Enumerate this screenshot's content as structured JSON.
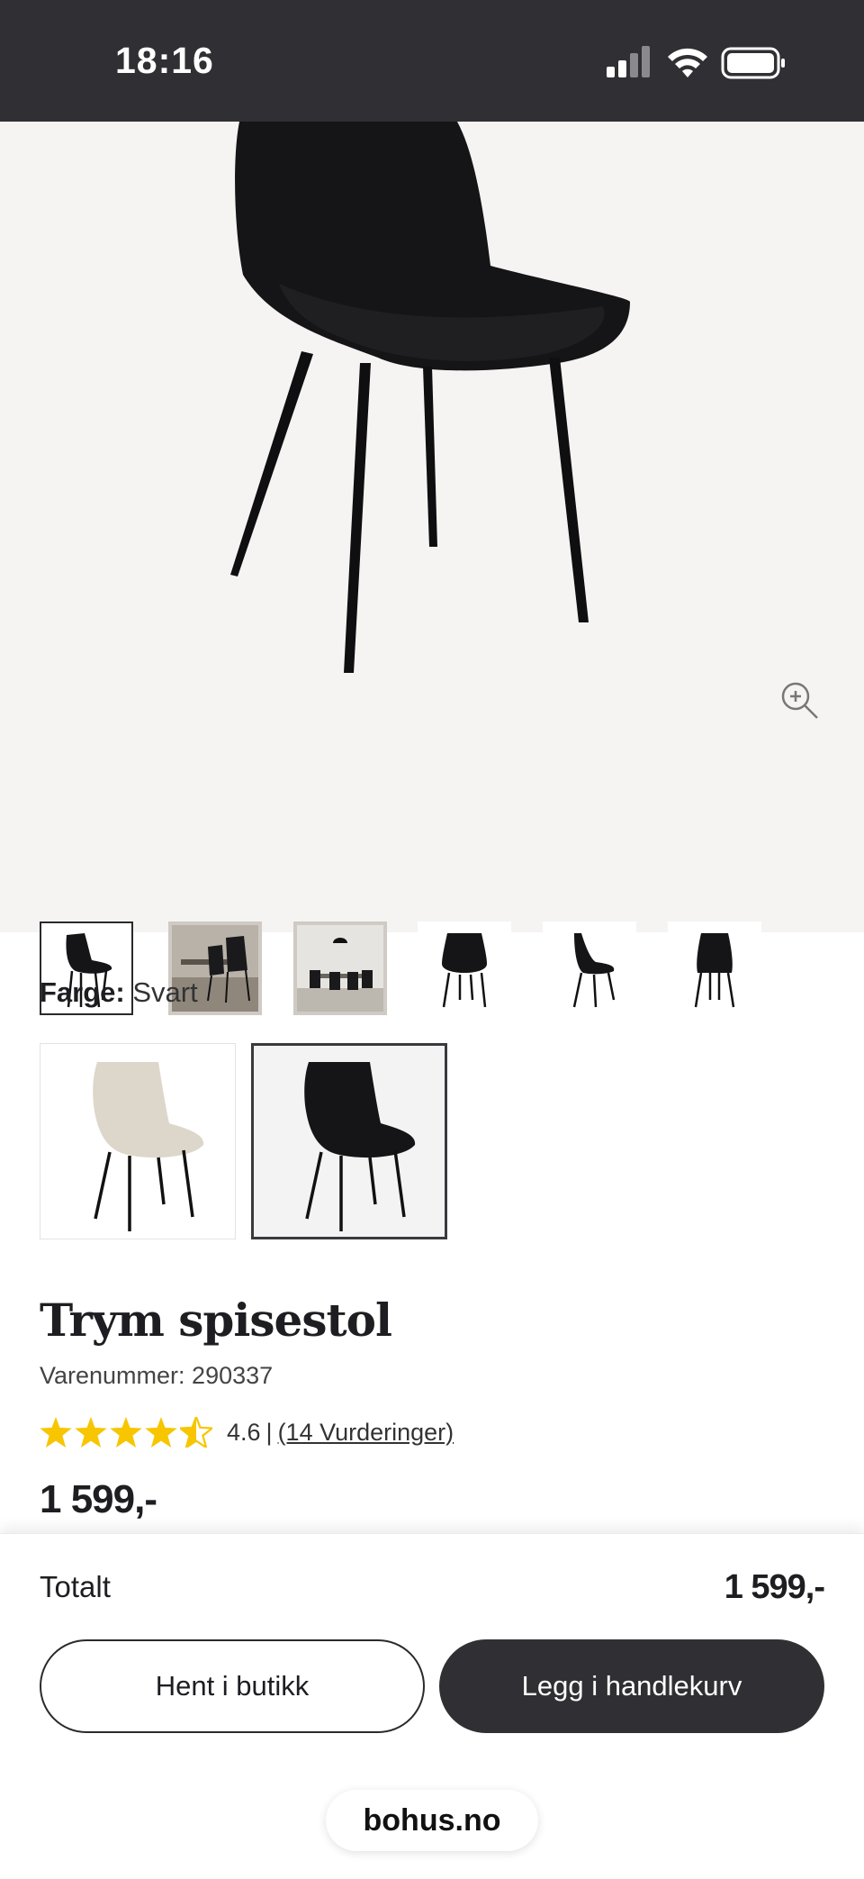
{
  "status_bar": {
    "time": "18:16",
    "icons": [
      "signal-icon",
      "wifi-icon",
      "battery-icon"
    ]
  },
  "gallery": {
    "main_image": "chair-black-image",
    "zoom_icon": "zoom-in-icon",
    "thumbnails": [
      {
        "name": "thumbnail-chair-side",
        "selected": true
      },
      {
        "name": "thumbnail-dining-room-1",
        "selected": false
      },
      {
        "name": "thumbnail-dining-room-2",
        "selected": false
      },
      {
        "name": "thumbnail-chair-front",
        "selected": false
      },
      {
        "name": "thumbnail-chair-profile",
        "selected": false
      },
      {
        "name": "thumbnail-chair-back",
        "selected": false
      }
    ]
  },
  "color": {
    "label": "Farge:",
    "value": "Svart",
    "options": [
      {
        "name": "beige",
        "selected": false,
        "hex": "#ddd6cb"
      },
      {
        "name": "black",
        "selected": true,
        "hex": "#1a1a1c"
      }
    ]
  },
  "product": {
    "title": "Trym spisestol",
    "sku": "Varenummer: 290337",
    "rating_value": "4.6",
    "rating_separator": "|",
    "rating_link": "(14 Vurderinger)",
    "rating_stars": 4.6,
    "price": "1 599,-"
  },
  "bottom": {
    "total_label": "Totalt",
    "total_value": "1 599,-",
    "pickup_button": "Hent i butikk",
    "cart_button": "Legg i handlekurv",
    "url": "bohus.no"
  },
  "colors": {
    "dark": "#303034",
    "star": "#f7c600",
    "hero_bg": "#f5f4f2"
  }
}
